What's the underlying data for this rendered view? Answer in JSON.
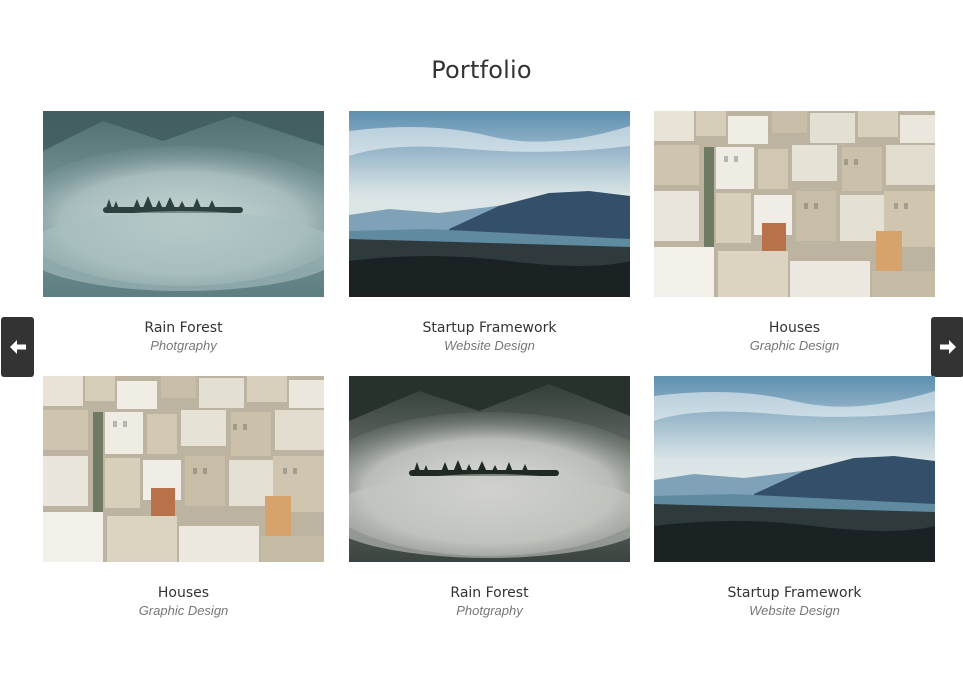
{
  "header": {
    "title": "Portfolio"
  },
  "portfolio": {
    "items": [
      {
        "title": "Rain Forest",
        "category": "Photgraphy",
        "image": "misty-forest-teal"
      },
      {
        "title": "Startup Framework",
        "category": "Website Design",
        "image": "mountain-valley"
      },
      {
        "title": "Houses",
        "category": "Graphic Design",
        "image": "city-houses"
      },
      {
        "title": "Houses",
        "category": "Graphic Design",
        "image": "city-houses"
      },
      {
        "title": "Rain Forest",
        "category": "Photgraphy",
        "image": "misty-forest-dark"
      },
      {
        "title": "Startup Framework",
        "category": "Website Design",
        "image": "mountain-valley"
      }
    ]
  },
  "carousel": {
    "prev_icon": "arrow-left-icon",
    "next_icon": "arrow-right-icon"
  },
  "colors": {
    "text": "#333333",
    "subtext": "#777777",
    "nav_bg": "#333333"
  }
}
